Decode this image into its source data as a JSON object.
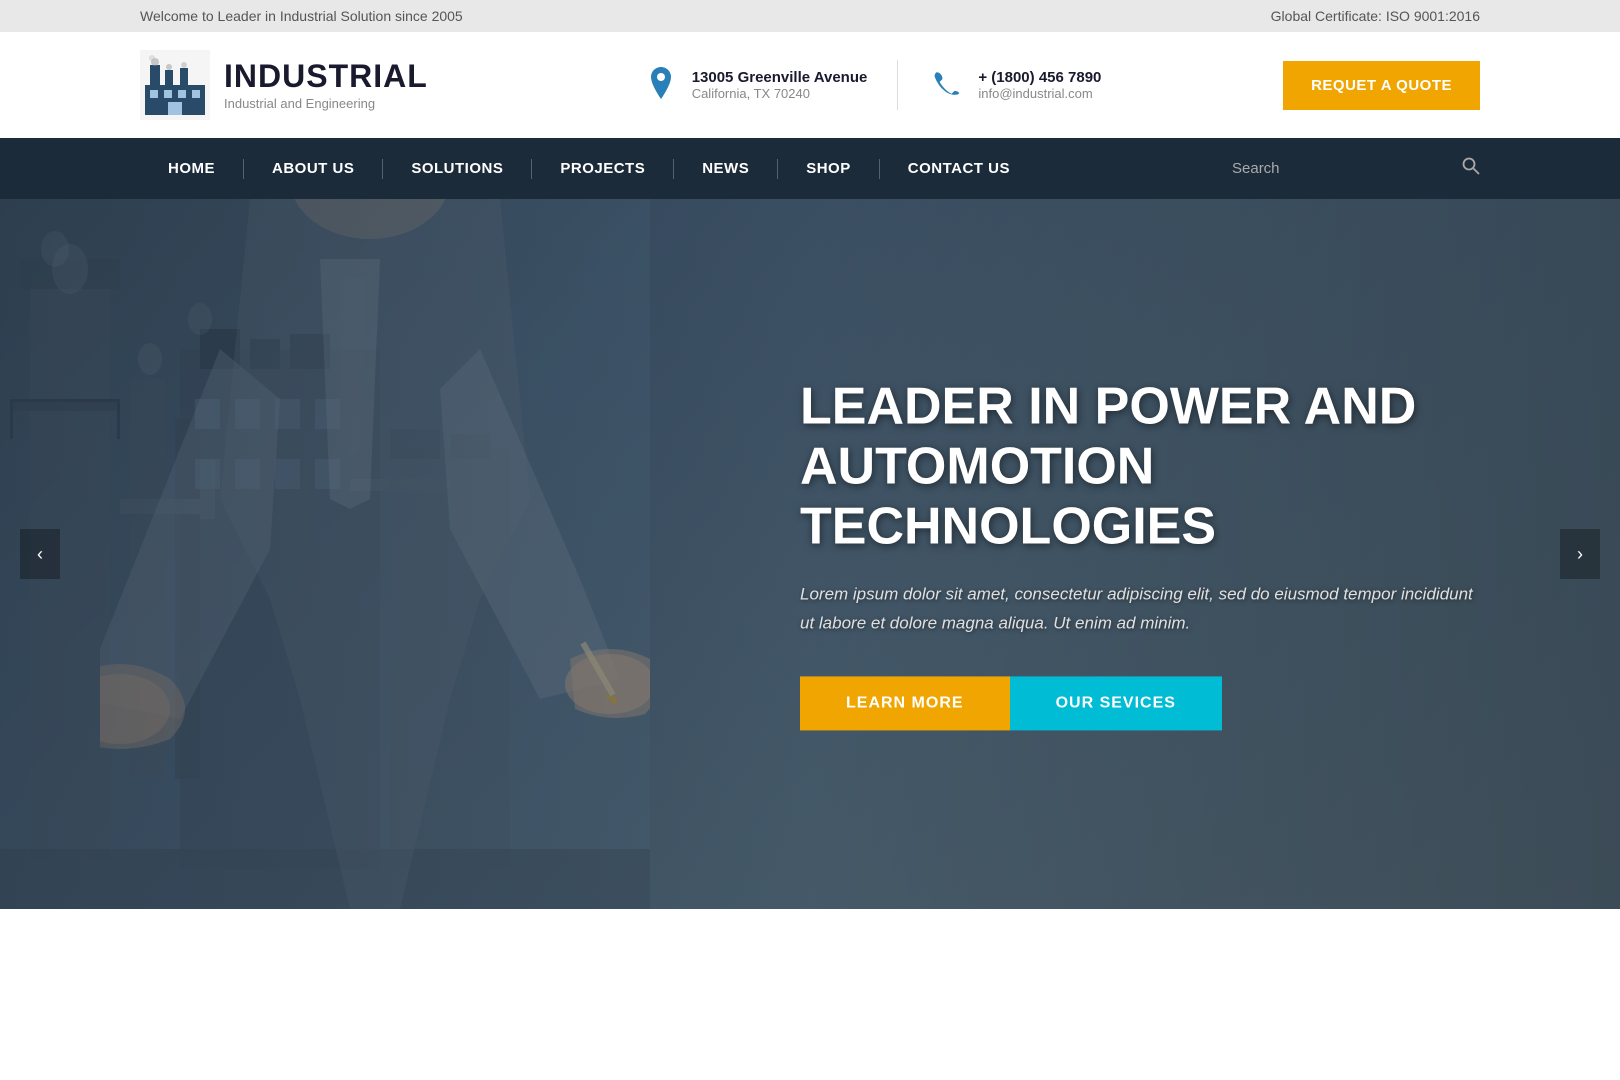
{
  "topbar": {
    "left_text": "Welcome to Leader in Industrial Solution since 2005",
    "right_text": "Global Certificate: ISO 9001:2016"
  },
  "header": {
    "logo": {
      "title": "INDUSTRIAL",
      "subtitle": "Industrial and Engineering"
    },
    "address": {
      "line1": "13005 Greenville Avenue",
      "line2": "California, TX 70240"
    },
    "phone": {
      "line1": "+ (1800) 456 7890",
      "line2": "info@industrial.com"
    },
    "quote_button": "REQUET A QUOTE"
  },
  "nav": {
    "items": [
      {
        "label": "HOME",
        "id": "home"
      },
      {
        "label": "ABOUT US",
        "id": "about"
      },
      {
        "label": "SOLUTIONS",
        "id": "solutions"
      },
      {
        "label": "PROJECTS",
        "id": "projects"
      },
      {
        "label": "NEWS",
        "id": "news"
      },
      {
        "label": "SHOP",
        "id": "shop"
      },
      {
        "label": "CONTACT US",
        "id": "contact"
      }
    ],
    "search_placeholder": "Search"
  },
  "hero": {
    "title": "LEADER IN POWER AND AUTOMOTION TECHNOLOGIES",
    "description": "Lorem ipsum dolor sit amet, consectetur adipiscing elit, sed do eiusmod tempor incididunt ut labore et dolore magna aliqua. Ut enim ad minim.",
    "btn_learn": "LEARN MORE",
    "btn_services": "OUR SEVICES"
  },
  "colors": {
    "nav_bg": "#1c2b3a",
    "accent_yellow": "#f0a500",
    "accent_cyan": "#00bcd4",
    "logo_color": "#1a1a2e"
  }
}
